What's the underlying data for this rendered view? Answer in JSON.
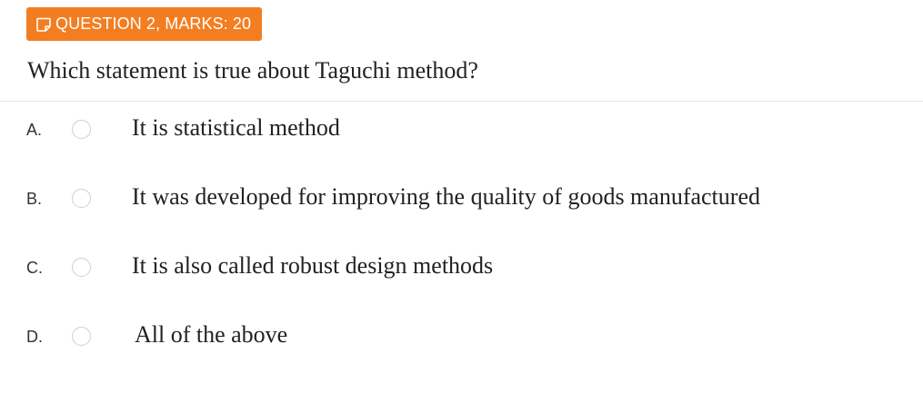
{
  "header": {
    "badge_label": "QUESTION 2, MARKS: 20",
    "badge_icon": "note-icon",
    "badge_color": "#f37e22"
  },
  "question": {
    "text": "Which statement is true about Taguchi method?"
  },
  "options": [
    {
      "letter": "A.",
      "text": "It is statistical method",
      "selected": false
    },
    {
      "letter": "B.",
      "text": "It was developed for improving the quality of goods manufactured",
      "selected": false
    },
    {
      "letter": "C.",
      "text": "It is also called robust design methods",
      "selected": false
    },
    {
      "letter": "D.",
      "text": "All of the above",
      "selected": false
    }
  ]
}
